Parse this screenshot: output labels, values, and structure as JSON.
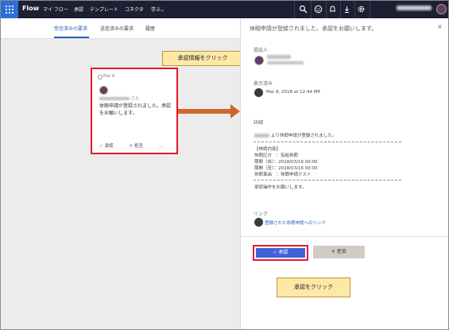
{
  "topbar": {
    "brand": "Flow",
    "nav": [
      "マイ フロー",
      "承認",
      "テンプレート",
      "コネクタ",
      "学ぶ"
    ],
    "learn_chevron": "⌄",
    "icons": [
      "search-icon",
      "smiley-icon",
      "bell-icon",
      "download-icon",
      "gear-icon"
    ]
  },
  "tabs": [
    "受信済みの要求",
    "送信済みの要求",
    "履歴"
  ],
  "card": {
    "date": "Mar 8",
    "san": "さん",
    "message": "休暇申請が登録されました。承認をお願いします。",
    "approve": "承認",
    "reject": "拒否",
    "more": "…"
  },
  "callouts": {
    "approval_info": "承認情報をクリック",
    "click_approve": "承認をクリック"
  },
  "detail": {
    "title": "休暇申請が登録されました。承認をお願いします。",
    "close": "×",
    "submitter_label": "提出人",
    "shown_label": "表示済み",
    "shown_date": "Mar 8, 2018 at 12:44 PM",
    "details_label": "詳細",
    "registered_line": "より休暇申請が登録されました。",
    "content_header": "【申請内容】",
    "rows": [
      "休暇区分　：有給休暇",
      "期間（自）：2018/03/16 00:00",
      "期間（至）：2018/03/16 00:00",
      "休暇事由　：休暇申請テスト"
    ],
    "request_line": "承認操作をお願いします。",
    "link_label": "リンク",
    "link_text": "登録された休暇申請へのリンク",
    "approve_button": "承認",
    "reject_button": "拒否",
    "check_glyph": "✓",
    "x_glyph": "✕"
  },
  "colors": {
    "topbar": "#1f1f33",
    "accent": "#2b5fb8",
    "highlight": "#e3192a",
    "arrow": "#d0672a",
    "approve_button": "#3f62d8",
    "callout": "#fde8a6"
  }
}
